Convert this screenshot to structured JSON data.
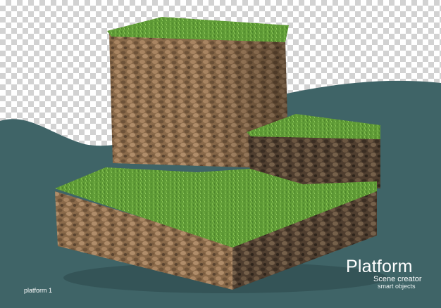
{
  "caption": {
    "title": "Platform",
    "subtitle": "Scene creator",
    "tagline": "smart objects"
  },
  "footer": {
    "label": "platform 1"
  },
  "colors": {
    "teal": "#3f6467",
    "grass": "#5e9a35",
    "grass_light": "#7bb64a",
    "soil": "#8a6a4a",
    "soil_dark": "#4c3a2b",
    "checker": "#d2d2d2"
  }
}
